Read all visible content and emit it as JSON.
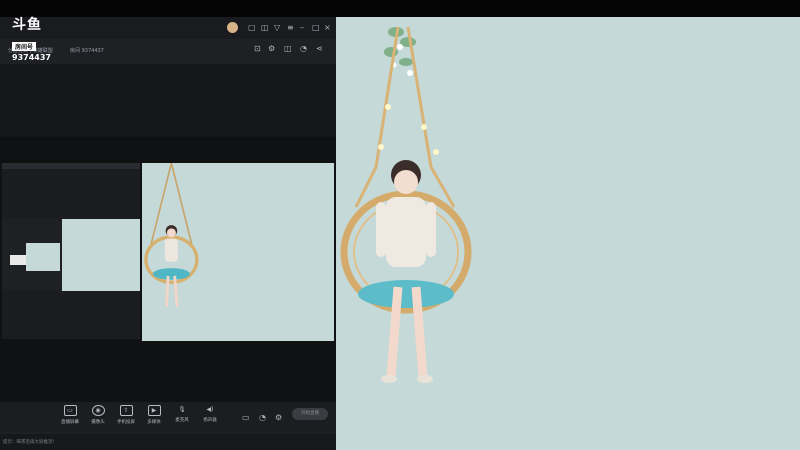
{
  "logo": {
    "brand": "斗鱼",
    "room_label": "房间号",
    "room_number": "9374437"
  },
  "infobar": {
    "room_text": "房间 9374437",
    "tags": "分区分类 | 英雄联盟"
  },
  "toolbar": {
    "items": [
      {
        "label": "直播屏幕",
        "icon": "screen-icon"
      },
      {
        "label": "摄像头",
        "icon": "camera-icon"
      },
      {
        "label": "手机投屏",
        "icon": "phone-cast-icon"
      },
      {
        "label": "多媒体",
        "icon": "media-icon"
      },
      {
        "label": "麦克风",
        "icon": "mic-icon"
      },
      {
        "label": "扬声器",
        "icon": "speaker-icon"
      }
    ],
    "start_label": "开始直播"
  },
  "statusbar": {
    "left_text": "提示：喝茶后再大屏推流！"
  }
}
